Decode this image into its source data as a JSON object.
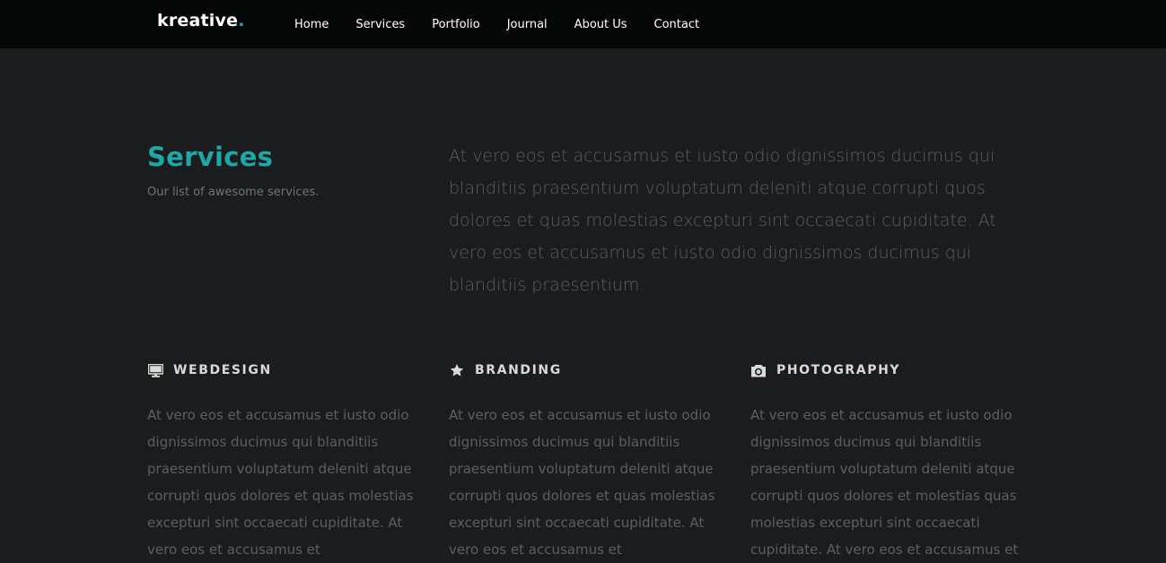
{
  "brand": {
    "name": "kreative",
    "dot": ".",
    "accent": "#1fa8a8"
  },
  "nav": {
    "items": [
      "Home",
      "Services",
      "Portfolio",
      "Journal",
      "About Us",
      "Contact"
    ]
  },
  "services_section": {
    "title": "Services",
    "subtitle": "Our list of awesome services.",
    "intro": "At vero eos et accusamus et iusto odio dignissimos ducimus qui blanditiis praesentium voluptatum deleniti atque corrupti quos dolores et quas molestias excepturi sint occaecati cupiditate. At vero eos et accusamus et iusto odio dignissimos ducimus qui blanditiis praesentium."
  },
  "services": [
    {
      "icon": "monitor-icon",
      "title": "WEBDESIGN",
      "text": "At vero eos et accusamus et iusto odio dignissimos ducimus qui blanditiis praesentium voluptatum deleniti atque corrupti quos dolores et quas molestias excepturi sint occaecati cupiditate. At vero eos et accusamus et"
    },
    {
      "icon": "star-icon",
      "title": "BRANDING",
      "text": "At vero eos et accusamus et iusto odio dignissimos ducimus qui blanditiis praesentium voluptatum deleniti atque corrupti quos dolores et quas molestias excepturi sint occaecati cupiditate. At vero eos et accusamus et"
    },
    {
      "icon": "camera-icon",
      "title": "PHOTOGRAPHY",
      "text": "At vero eos et accusamus et iusto odio dignissimos ducimus qui blanditiis praesentium voluptatum deleniti atque corrupti quos dolores et molestias quas molestias excepturi sint occaecati cupiditate. At vero eos et accusamus et"
    }
  ]
}
